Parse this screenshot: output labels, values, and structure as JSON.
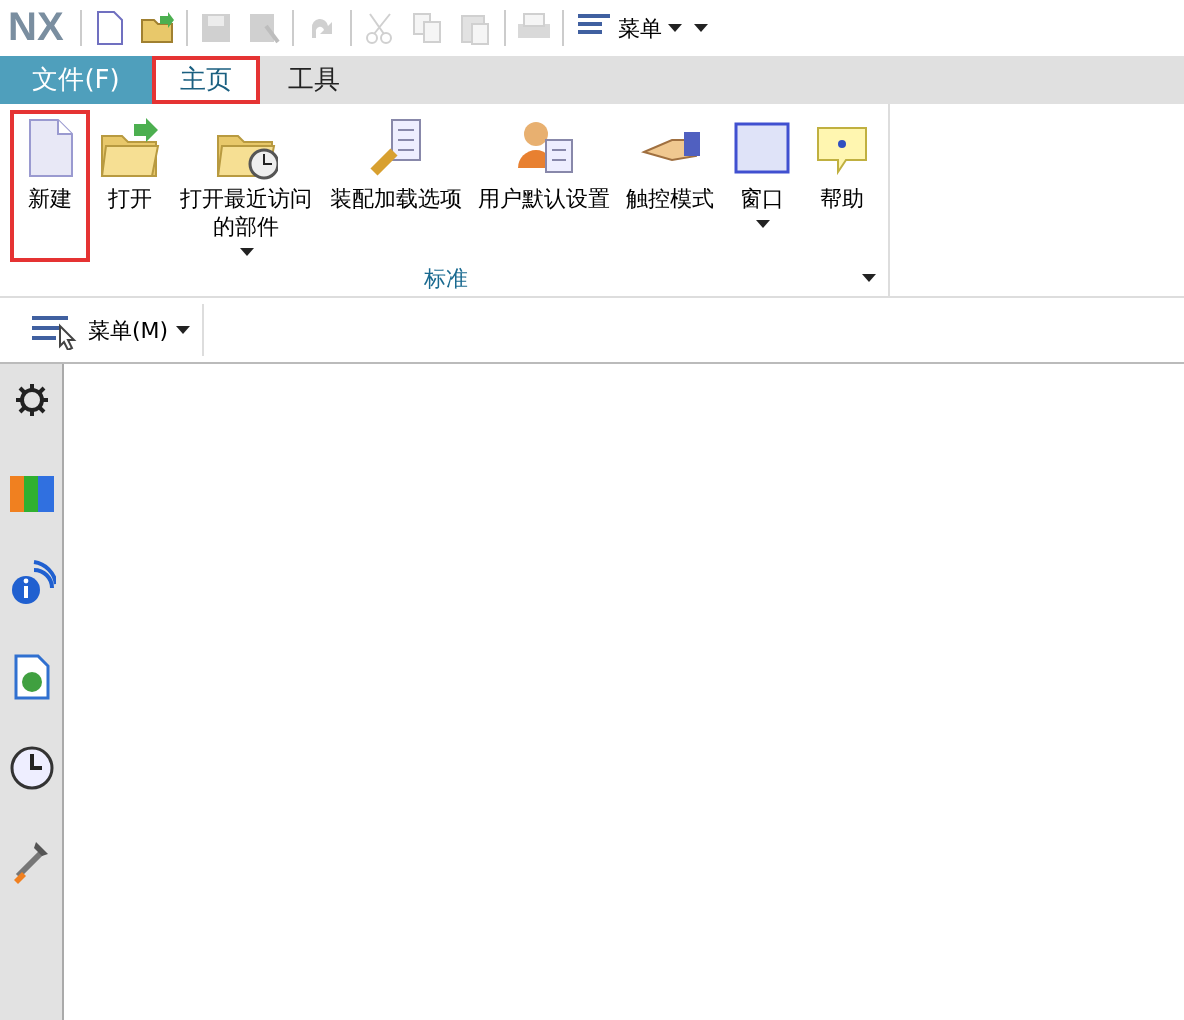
{
  "app_logo": "NX",
  "quick_access": [
    {
      "kind": "new",
      "disabled": false
    },
    {
      "kind": "open",
      "disabled": false
    },
    {
      "kind": "save",
      "disabled": true
    },
    {
      "kind": "save-as",
      "disabled": true
    },
    {
      "kind": "redo",
      "disabled": true
    },
    {
      "kind": "cut",
      "disabled": true
    },
    {
      "kind": "copy",
      "disabled": true
    },
    {
      "kind": "paste",
      "disabled": true
    },
    {
      "kind": "print",
      "disabled": true
    }
  ],
  "quick_menu": {
    "label": "菜单"
  },
  "tabs": [
    {
      "label": "文件(F)",
      "kind": "file",
      "selected": false,
      "highlighted": false
    },
    {
      "label": "主页",
      "kind": "tab",
      "selected": true,
      "highlighted": true
    },
    {
      "label": "工具",
      "kind": "tab",
      "selected": false,
      "highlighted": false
    }
  ],
  "ribbon": {
    "group_label": "标准",
    "buttons": [
      {
        "label": "新建",
        "kind": "new",
        "dropdown": false,
        "highlighted": true
      },
      {
        "label": "打开",
        "kind": "open",
        "dropdown": false,
        "highlighted": false
      },
      {
        "label": "打开最近访问的部件",
        "kind": "recent",
        "dropdown": true,
        "highlighted": false
      },
      {
        "label": "装配加载选项",
        "kind": "assembly",
        "dropdown": false,
        "highlighted": false
      },
      {
        "label": "用户默认设置",
        "kind": "user",
        "dropdown": false,
        "highlighted": false
      },
      {
        "label": "触控模式",
        "kind": "touch",
        "dropdown": false,
        "highlighted": false
      },
      {
        "label": "窗口",
        "kind": "window",
        "dropdown": true,
        "highlighted": false
      },
      {
        "label": "帮助",
        "kind": "help",
        "dropdown": false,
        "highlighted": false
      }
    ]
  },
  "toolbar": {
    "menu_label": "菜单(M)"
  },
  "sidebar": [
    {
      "kind": "settings"
    },
    {
      "kind": "books"
    },
    {
      "kind": "info"
    },
    {
      "kind": "web"
    },
    {
      "kind": "clock"
    },
    {
      "kind": "tools"
    }
  ]
}
